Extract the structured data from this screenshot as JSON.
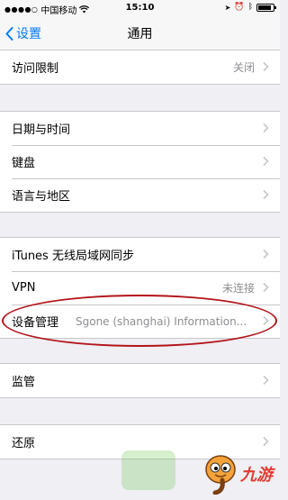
{
  "status": {
    "carrier": "中国移动",
    "time": "15:10",
    "battery_level": 0.85
  },
  "nav": {
    "back_label": "设置",
    "title": "通用"
  },
  "groups": [
    {
      "rows": [
        {
          "label": "访问限制",
          "value": "关闭"
        }
      ]
    },
    {
      "rows": [
        {
          "label": "日期与时间"
        },
        {
          "label": "键盘"
        },
        {
          "label": "语言与地区"
        }
      ]
    },
    {
      "rows": [
        {
          "label": "iTunes 无线局域网同步"
        },
        {
          "label": "VPN",
          "value": "未连接"
        },
        {
          "label": "设备管理",
          "value": "Sgone (shanghai) Information..."
        }
      ]
    },
    {
      "rows": [
        {
          "label": "监管"
        }
      ]
    },
    {
      "rows": [
        {
          "label": "还原"
        }
      ]
    }
  ],
  "watermark": {
    "text": "九游"
  },
  "colors": {
    "accent": "#007aff",
    "highlight": "#b3141a",
    "watermark": "#e23b2f"
  }
}
